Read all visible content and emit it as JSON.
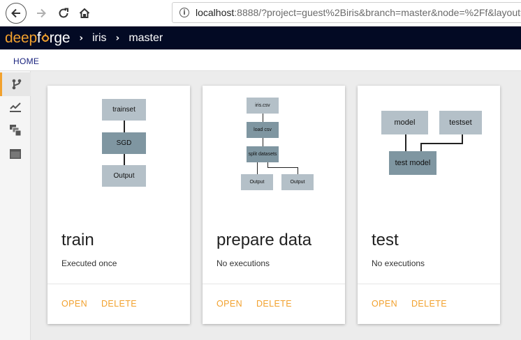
{
  "browser": {
    "url_host": "localhost",
    "url_rest": ":8888/?project=guest%2Biris&branch=master&node=%2Ff&layout=",
    "icons": {
      "back": "arrow-left-icon",
      "forward": "arrow-right-icon",
      "reload": "reload-icon",
      "home": "home-icon",
      "info": "info-icon"
    }
  },
  "header": {
    "logo_part1": "deep",
    "logo_part2": "f",
    "logo_part3": "rge",
    "breadcrumbs": [
      "iris",
      "master"
    ],
    "colors": {
      "background": "#030a24",
      "accent": "#f2a12d"
    }
  },
  "subheader": {
    "home_label": "HOME"
  },
  "sidebar": {
    "items": [
      {
        "icon": "branch-icon",
        "active": true
      },
      {
        "icon": "chart-line-icon",
        "active": false
      },
      {
        "icon": "layers-icon",
        "active": false
      },
      {
        "icon": "window-icon",
        "active": false
      }
    ]
  },
  "cards": [
    {
      "title": "train",
      "subtitle": "Executed once",
      "open_label": "OPEN",
      "delete_label": "DELETE",
      "nodes": [
        "trainset",
        "SGD",
        "Output"
      ]
    },
    {
      "title": "prepare data",
      "subtitle": "No executions",
      "open_label": "OPEN",
      "delete_label": "DELETE",
      "nodes": [
        "iris.csv",
        "load csv",
        "split datasets",
        "Output",
        "Output"
      ]
    },
    {
      "title": "test",
      "subtitle": "No executions",
      "open_label": "OPEN",
      "delete_label": "DELETE",
      "nodes": [
        "model",
        "testset",
        "test model"
      ]
    }
  ]
}
